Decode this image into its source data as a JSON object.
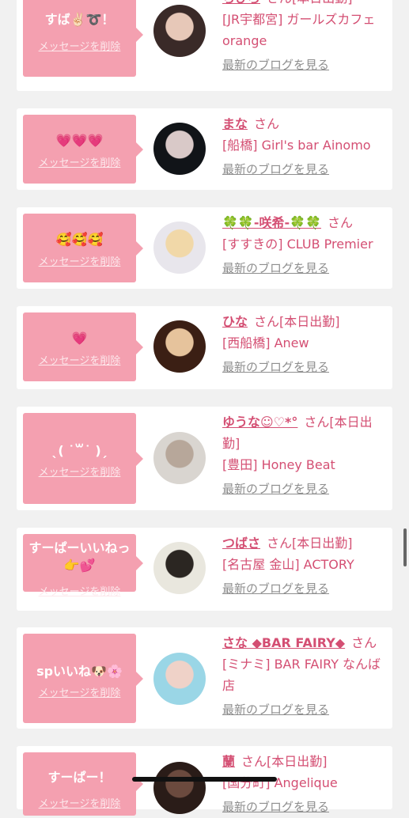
{
  "cards": [
    {
      "message": "すば✌🏻➰！",
      "delete_label": "メッセージを削除",
      "name": "ちひろ",
      "san": "さん",
      "status": "[本日出勤]",
      "shop": "[JR宇都宮] ガールズカフェ orange",
      "blog_label": "最新のブログを見る",
      "avatar_colors": [
        "#3a2a28",
        "#e7c8b8"
      ]
    },
    {
      "message": "💗💗💗",
      "delete_label": "メッセージを削除",
      "name": "まな",
      "san": "さん",
      "status": "",
      "shop": "[船橋] Girl's bar Ainomo",
      "blog_label": "最新のブログを見る",
      "avatar_colors": [
        "#111418",
        "#d9c9c8"
      ]
    },
    {
      "message": "🥰🥰🥰",
      "delete_label": "メッセージを削除",
      "name": "🍀🍀-咲希-🍀🍀",
      "san": "さん",
      "status": "",
      "shop": "[すすきの] CLUB Premier",
      "blog_label": "最新のブログを見る",
      "avatar_colors": [
        "#e8e6ec",
        "#f1d8a8"
      ]
    },
    {
      "message": "💗",
      "delete_label": "メッセージを削除",
      "name": "ひな",
      "san": "さん",
      "status": "[本日出勤]",
      "shop": "[西船橋] Anew",
      "blog_label": "最新のブログを見る",
      "avatar_colors": [
        "#3b1f14",
        "#e6c39c"
      ]
    },
    {
      "message": "ˎ( ˙꒳˙ )ˏ",
      "delete_label": "メッセージを削除",
      "name": "ゆうな☺︎♡*°",
      "san": "さん",
      "status": "[本日出勤]",
      "shop": "[豊田] Honey Beat",
      "blog_label": "最新のブログを見る",
      "avatar_colors": [
        "#d9d5d0",
        "#b7a79a"
      ]
    },
    {
      "message": "すーぱーいいねっ👉💕",
      "delete_label": "メッセージを削除",
      "name": "つばさ",
      "san": "さん",
      "status": "[本日出勤]",
      "shop": "[名古屋 金山] ACTORY",
      "blog_label": "最新のブログを見る",
      "avatar_colors": [
        "#e9e7de",
        "#2b2622"
      ]
    },
    {
      "message": "spいいね🐶🌸",
      "delete_label": "メッセージを削除",
      "name": "さな ◆BAR FAIRY◆",
      "san": "さん",
      "status": "",
      "shop": "[ミナミ] BAR FAIRY なんば店",
      "blog_label": "最新のブログを見る",
      "avatar_colors": [
        "#9ad6e6",
        "#efd2c8"
      ]
    },
    {
      "message": "すーぱー！",
      "delete_label": "メッセージを削除",
      "name": "蘭",
      "san": "さん",
      "status": "[本日出勤]",
      "shop": "[国分町] Angelique",
      "blog_label": "最新のブログを見る",
      "avatar_colors": [
        "#2a1c18",
        "#6b4a3e"
      ]
    }
  ]
}
